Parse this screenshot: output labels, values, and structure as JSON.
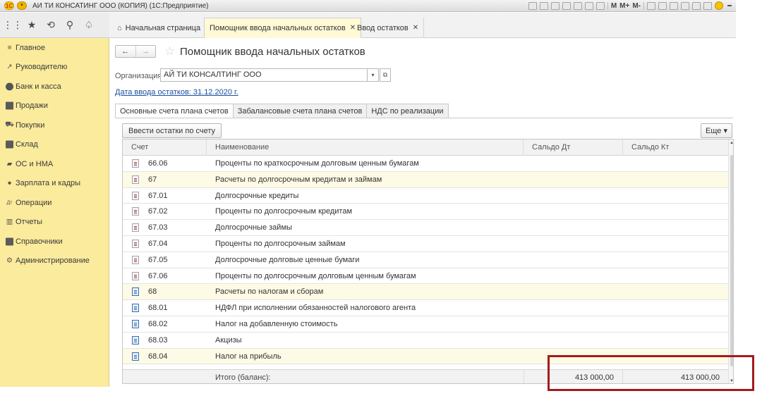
{
  "window": {
    "logo": "1С",
    "title": "АИ ТИ КОНСАТИНГ ООО (КОПИЯ) (1С:Предприятие)",
    "tools": [
      "M",
      "M+",
      "M-"
    ]
  },
  "topbar": {
    "icons": [
      "apps-grid-icon",
      "favorites-star-icon",
      "history-icon",
      "search-icon",
      "notifications-bell-icon"
    ]
  },
  "sidebar": {
    "items": [
      {
        "label": "Главное",
        "icon": "menu-lines-icon"
      },
      {
        "label": "Руководителю",
        "icon": "trend-chart-icon"
      },
      {
        "label": "Банк и касса",
        "icon": "bank-coin-icon"
      },
      {
        "label": "Продажи",
        "icon": "shopping-bag-icon"
      },
      {
        "label": "Покупки",
        "icon": "cart-icon"
      },
      {
        "label": "Склад",
        "icon": "warehouse-icon"
      },
      {
        "label": "ОС и НМА",
        "icon": "truck-icon"
      },
      {
        "label": "Зарплата и кадры",
        "icon": "person-icon"
      },
      {
        "label": "Операции",
        "icon": "dt-kt-icon"
      },
      {
        "label": "Отчеты",
        "icon": "bar-chart-icon"
      },
      {
        "label": "Справочники",
        "icon": "book-icon"
      },
      {
        "label": "Администрирование",
        "icon": "gear-icon"
      }
    ]
  },
  "window_tabs": [
    {
      "label": "Начальная страница"
    },
    {
      "label": "Помощник ввода начальных остатков"
    },
    {
      "label": "Ввод остатков"
    }
  ],
  "form": {
    "title": "Помощник ввода начальных остатков",
    "org_label": "Организация:",
    "org_value": "АЙ ТИ КОНСАЛТИНГ ООО",
    "date_link": "Дата ввода остатков: 31.12.2020 г.",
    "tabs": [
      "Основные счета плана счетов",
      "Забалансовые счета плана счетов",
      "НДС по реализации"
    ],
    "enter_button": "Ввести остатки по счету",
    "more_button": "Еще ▾"
  },
  "table": {
    "columns": [
      "Счет",
      "Наименование",
      "Сальдо Дт",
      "Сальдо Кт"
    ],
    "rows": [
      {
        "account": "66.06",
        "name": "Проценты по краткосрочным долговым ценным бумагам",
        "icon": "doc-red"
      },
      {
        "account": "67",
        "name": "Расчеты по долгосрочным кредитам и займам",
        "icon": "doc-red",
        "highlight": true
      },
      {
        "account": "67.01",
        "name": "Долгосрочные кредиты",
        "icon": "doc-red"
      },
      {
        "account": "67.02",
        "name": "Проценты по долгосрочным кредитам",
        "icon": "doc-red"
      },
      {
        "account": "67.03",
        "name": "Долгосрочные займы",
        "icon": "doc-red"
      },
      {
        "account": "67.04",
        "name": "Проценты по долгосрочным займам",
        "icon": "doc-red"
      },
      {
        "account": "67.05",
        "name": "Долгосрочные долговые ценные бумаги",
        "icon": "doc-red"
      },
      {
        "account": "67.06",
        "name": "Проценты по долгосрочным долговым ценным бумагам",
        "icon": "doc-red"
      },
      {
        "account": "68",
        "name": "Расчеты по налогам и сборам",
        "icon": "doc-blue",
        "highlight": true
      },
      {
        "account": "68.01",
        "name": "НДФЛ при исполнении обязанностей налогового агента",
        "icon": "doc-blue"
      },
      {
        "account": "68.02",
        "name": "Налог на добавленную стоимость",
        "icon": "doc-blue"
      },
      {
        "account": "68.03",
        "name": "Акцизы",
        "icon": "doc-blue"
      },
      {
        "account": "68.04",
        "name": "Налог на прибыль",
        "icon": "doc-blue",
        "highlight": true
      }
    ],
    "total_label": "Итого (баланс):",
    "total_dt": "413 000,00",
    "total_kt": "413 000,00"
  },
  "colors": {
    "sidebar_bg": "#fbeb9c",
    "row_highlight": "#fdfbe5",
    "link": "#1a4fa0",
    "annotation_box": "#a31b1b"
  }
}
